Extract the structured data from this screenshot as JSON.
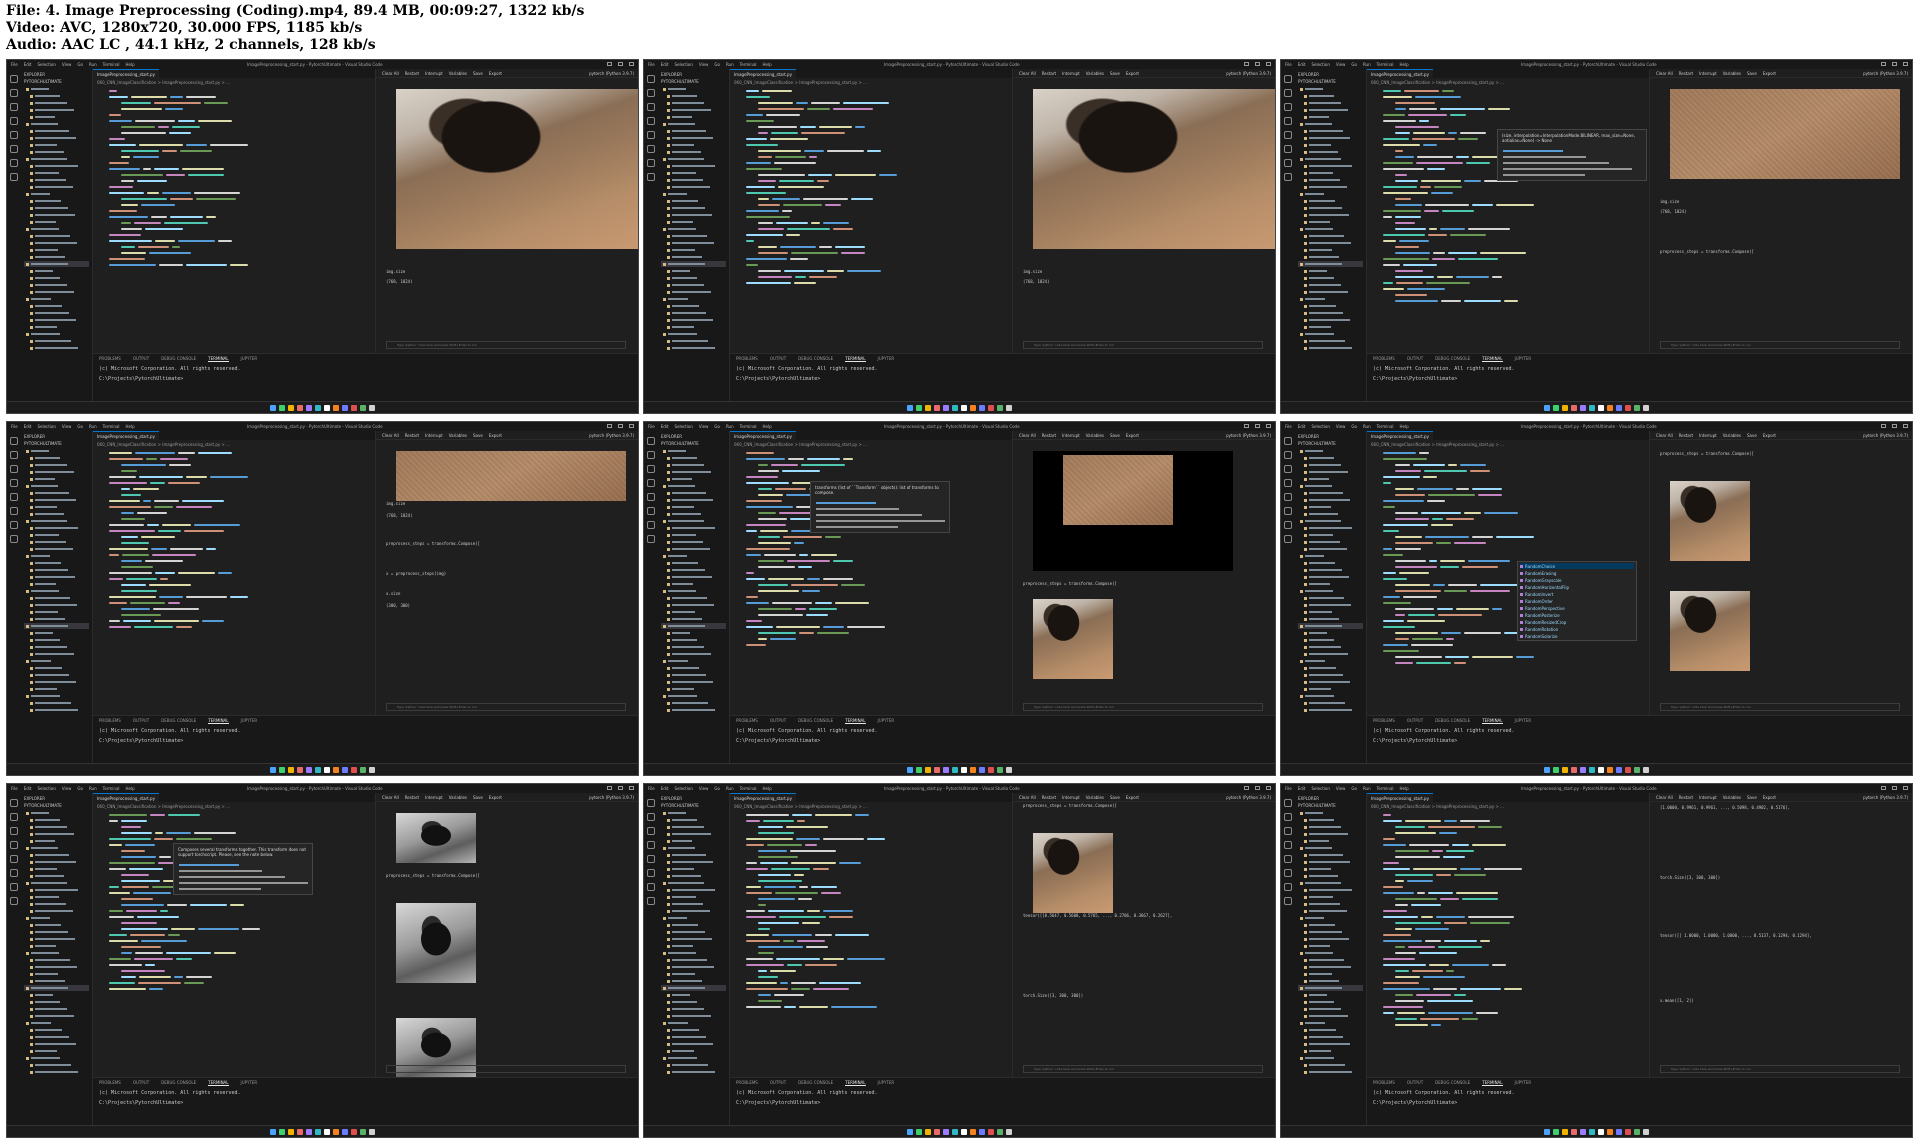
{
  "header": {
    "file": "File: 4. Image Preprocessing (Coding).mp4, 89.4 MB, 00:09:27, 1322 kb/s",
    "video": "Video: AVC, 1280x720, 30.000 FPS, 1185 kb/s",
    "audio": "Audio: AAC LC , 44.1 kHz, 2 channels, 128 kb/s"
  },
  "common": {
    "menu_items": [
      "File",
      "Edit",
      "Selection",
      "View",
      "Go",
      "Run",
      "Terminal",
      "Help"
    ],
    "window_title": "ImagePreprocessing_start.py - PytorchUltimate - Visual Studio Code",
    "explorer_header": "EXPLORER",
    "explorer_root": "PYTORCHULTIMATE",
    "editor_tab": "ImagePreprocessing_start.py",
    "breadcrumb": "060_CNN_ImageClassification > ImagePreprocessing_start.py > ...",
    "interactive_toolbar": [
      "Clear All",
      "Restart",
      "Interrupt",
      "Variables",
      "Save",
      "Export"
    ],
    "kernel": "pytorch (Python 3.9.7)",
    "panel_tabs": [
      "PROBLEMS",
      "OUTPUT",
      "DEBUG CONSOLE",
      "TERMINAL",
      "JUPYTER"
    ],
    "terminal_line_1": "(c) Microsoft Corporation. All rights reserved.",
    "terminal_line_2": "C:\\Projects\\PytorchUltimate>",
    "input_placeholder": "Type 'python' code here and press Shift+Enter to run",
    "taskbar_colors": [
      "#4aa3ff",
      "#3ecf6e",
      "#f0b400",
      "#e86a6a",
      "#9b7bff",
      "#2fb9c4",
      "#ffffff",
      "#f58220",
      "#6c7bff",
      "#e04f4f",
      "#58b368",
      "#d1d1d1"
    ],
    "accent_color": "#0078d4",
    "editor_bg": "#1f1f1f"
  },
  "frames": [
    {
      "outputs": [
        "img.size",
        "(768, 1024)"
      ]
    },
    {
      "outputs": [
        "img.size",
        "(768, 1024)"
      ]
    },
    {
      "hover": "(size, interpolation=InterpolationMode.BILINEAR, max_size=None, antialias=None) -> None",
      "outputs": [
        "img.size",
        "(768, 1024)",
        "preprocess_steps = transforms.Compose(["
      ]
    },
    {
      "outputs": [
        "img.size",
        "(768, 1024)",
        "preprocess_steps = transforms.Compose([",
        "x = preprocess_steps(img)",
        "x.size",
        "(300, 300)"
      ]
    },
    {
      "hover": "transforms (list of ``Transform`` objects): list of transforms to compose.",
      "outputs": [
        "preprocess_steps = transforms.Compose(["
      ]
    },
    {
      "suggestions": [
        "RandomChoice",
        "RandomErasing",
        "RandomGrayscale",
        "RandomHorizontalFlip",
        "RandomInvert",
        "RandomOrder",
        "RandomPerspective",
        "RandomPosterize",
        "RandomResizedCrop",
        "RandomRotation",
        "RandomSolarize"
      ],
      "outputs": [
        "preprocess_steps = transforms.Compose(["
      ]
    },
    {
      "hover": "Composes several transforms together. This transform does not support torchscript. Please, see the note below.",
      "outputs": [
        "preprocess_steps = transforms.Compose(["
      ]
    },
    {
      "outputs": [
        "preprocess_steps = transforms.Compose([",
        "tensor([[0.5647, 0.5608, 0.5765, ..., 0.2706, 0.3667, 0.2627],",
        "torch.Size([3, 300, 300])"
      ]
    },
    {
      "outputs": [
        "[1.0000, 0.9961, 0.9961, ..., 0.5098, 0.4902, 0.5176],",
        "torch.Size([3, 300, 300])",
        "tensor([[ 1.0000, 1.0000, 1.0000, ..., 0.5137, 0.1294, 0.1294],",
        "x.mean([1, 2])"
      ]
    }
  ]
}
